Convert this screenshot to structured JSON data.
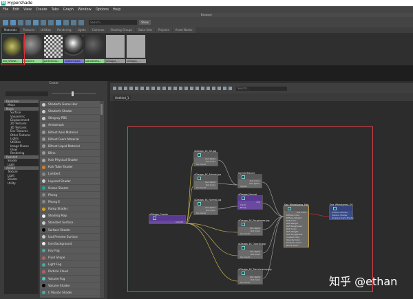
{
  "window": {
    "title": "Hypershade",
    "logo": "H"
  },
  "menu": [
    "File",
    "Edit",
    "View",
    "Create",
    "Tabs",
    "Graph",
    "Window",
    "Options",
    "Help"
  ],
  "browser": {
    "title": "Browser",
    "search_placeholder": "Search...",
    "show_label": "Show",
    "tabs": [
      "Materials",
      "Textures",
      "Utilities",
      "Rendering",
      "Lights",
      "Cameras",
      "Shading Groups",
      "Bake Sets",
      "Projects",
      "Asset Nodes"
    ],
    "active_tab": 0,
    "swatches": [
      {
        "label": "Sea_Wheat...",
        "kind": "grass",
        "tag": "green"
      },
      {
        "label": "lambert1",
        "kind": "sphere",
        "tag": "green"
      },
      {
        "label": "particleClo...",
        "kind": "checker",
        "tag": "green"
      },
      {
        "label": "shaderGlow1",
        "kind": "chrome",
        "tag": "blue"
      },
      {
        "label": "standardSu...",
        "kind": "dark",
        "tag": "green"
      },
      {
        "label": "uDiagga_...",
        "kind": "plane",
        "tag": "gray"
      },
      {
        "label": "uDiagga_...",
        "kind": "plane",
        "tag": "gray"
      }
    ]
  },
  "create": {
    "title": "Create",
    "tree": [
      {
        "label": "Favorites",
        "type": "hdr"
      },
      {
        "label": "Maya",
        "type": "sub"
      },
      {
        "label": "Maya",
        "type": "hdr"
      },
      {
        "label": "Surface"
      },
      {
        "label": "Volumetric"
      },
      {
        "label": "Displacement"
      },
      {
        "label": "2D Textures"
      },
      {
        "label": "3D Textures"
      },
      {
        "label": "Env Textures"
      },
      {
        "label": "Other Textures"
      },
      {
        "label": "Lights"
      },
      {
        "label": "Utilities"
      },
      {
        "label": "Image Planes"
      },
      {
        "label": "Glow"
      },
      {
        "label": "Rendering"
      },
      {
        "label": "Redshift",
        "type": "hdr"
      },
      {
        "label": "Shader",
        "type": "sub"
      },
      {
        "label": "Light",
        "type": "sub"
      },
      {
        "label": "Arnold",
        "type": "hdr"
      },
      {
        "label": "Texture",
        "type": "sub"
      },
      {
        "label": "Light",
        "type": "sub"
      },
      {
        "label": "Shader",
        "type": "sub"
      },
      {
        "label": "Utility",
        "type": "sub"
      }
    ],
    "items": [
      "Shaderfx Game Hair",
      "Shaderfx Shader",
      "Stingray PBS",
      "Anisotropic",
      "Bifrost Aero Material",
      "Bifrost Foam Material",
      "Bifrost Liquid Material",
      "Blinn",
      "Hair Physical Shader",
      "Hair Tube Shader",
      "Lambert",
      "Layered Shader",
      "Ocean Shader",
      "Phong",
      "Phong E",
      "Ramp Shader",
      "Shading Map",
      "Standard Surface",
      "Surface Shader",
      "Usd Preview Surface",
      "Use Background",
      "Env Fog",
      "Fluid Shape",
      "Light Fog",
      "Particle Cloud",
      "Volume Fog",
      "Volume Shader",
      "C Muscle Shader"
    ]
  },
  "graph": {
    "tab": "Untitled_1",
    "search_placeholder": "Search...",
    "nodes": [
      {
        "id": "coords",
        "name": "uDiagga_Coords",
        "style": "purple",
        "ports": [
          {
            "t": "Out UV",
            "r": true
          }
        ]
      },
      {
        "id": "ao",
        "name": "uDiagga_4K_AO.jpg",
        "style": "file",
        "ports": [
          {
            "t": "Out Alpha",
            "r": true
          },
          {
            "t": "Out Color",
            "r": true
          },
          {
            "t": "Uv Coord"
          }
        ]
      },
      {
        "id": "albedo",
        "name": "uDiagga_4K_Albedo.jpg",
        "style": "file",
        "ports": [
          {
            "t": "Out Alpha",
            "r": true
          },
          {
            "t": "Out Color",
            "r": true
          },
          {
            "t": "Uv Coord"
          }
        ]
      },
      {
        "id": "normalmap",
        "name": "uDiagga_4K_Normal.jpg",
        "style": "file",
        "ports": [
          {
            "t": "Out Alpha",
            "r": true
          },
          {
            "t": "Out Color",
            "r": true
          },
          {
            "t": "Uv Coord"
          }
        ]
      },
      {
        "id": "layered",
        "name": "layeredTexture",
        "style": "file",
        "ports": [
          {
            "t": "Out Color",
            "r": true
          },
          {
            "t": "Out Alpha",
            "r": true
          },
          {
            "t": "Inputs"
          }
        ]
      },
      {
        "id": "normal",
        "name": "uDiagga_Normal",
        "style": "purple",
        "ports": [
          {
            "t": "Out",
            "r": true
          },
          {
            "t": "Input"
          },
          {
            "t": "Bump"
          }
        ]
      },
      {
        "id": "rough",
        "name": "uDiagga_4K_Roughness.jpg",
        "style": "file",
        "ports": [
          {
            "t": "Out Alpha",
            "r": true
          },
          {
            "t": "Out Color",
            "r": true
          },
          {
            "t": "Uv Coord"
          }
        ]
      },
      {
        "id": "opacity",
        "name": "uDiagga_4K_Opacity.jpg",
        "style": "file",
        "ports": [
          {
            "t": "Out Alpha",
            "r": true
          },
          {
            "t": "Out Color",
            "r": true
          },
          {
            "t": "Uv Coord"
          }
        ]
      },
      {
        "id": "transl",
        "name": "uDiagga_4K_Translucency.jpg",
        "style": "file",
        "ports": [
          {
            "t": "Out Alpha",
            "r": true
          },
          {
            "t": "Out Color",
            "r": true
          },
          {
            "t": "Uv Coord"
          }
        ]
      },
      {
        "id": "mat",
        "name": "Sea_Wheatgrass_Mat",
        "style": "sel",
        "ports": [
          {
            "t": "Out Color",
            "r": true
          },
          {
            "t": "Diffuse Color"
          },
          {
            "t": "Diffuse Weight"
          },
          {
            "t": "Refl Color"
          },
          {
            "t": "Refl Weight"
          },
          {
            "t": "Refl Roughness"
          },
          {
            "t": "Refr Color"
          },
          {
            "t": "Refr Weight"
          },
          {
            "t": "Refr Roughness"
          },
          {
            "t": "Coated Color"
          },
          {
            "t": "Opacity Color"
          },
          {
            "t": "Emission Color"
          },
          {
            "t": "Bump Input"
          }
        ]
      },
      {
        "id": "sg",
        "name": "Sea_Wheatgrass_SG",
        "style": "blue",
        "ports": [
          {
            "t": "Surface Shader"
          },
          {
            "t": "Volume Shader"
          },
          {
            "t": "Displacement Shader"
          }
        ]
      }
    ],
    "wires": [
      [
        "coords",
        "ao"
      ],
      [
        "coords",
        "albedo"
      ],
      [
        "coords",
        "normalmap"
      ],
      [
        "coords",
        "rough"
      ],
      [
        "coords",
        "opacity"
      ],
      [
        "coords",
        "transl"
      ],
      [
        "ao",
        "layered"
      ],
      [
        "albedo",
        "layered"
      ],
      [
        "normalmap",
        "normal"
      ],
      [
        "layered",
        "mat"
      ],
      [
        "normal",
        "mat"
      ],
      [
        "rough",
        "mat"
      ],
      [
        "opacity",
        "mat"
      ],
      [
        "transl",
        "mat"
      ],
      [
        "mat",
        "sg"
      ]
    ]
  },
  "watermark": "知乎 @ethan"
}
